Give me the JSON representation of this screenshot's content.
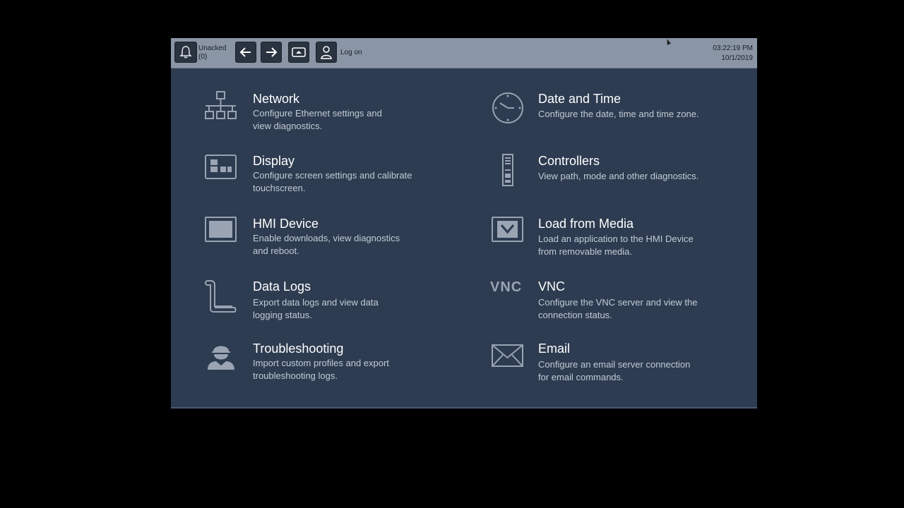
{
  "topbar": {
    "alarm_label_line1": "Unacked",
    "alarm_label_line2": "(0)",
    "logon_label": "Log on",
    "time": "03:22:19 PM",
    "date": "10/1/2019"
  },
  "tiles": [
    {
      "title": "Network",
      "desc1": "Configure Ethernet settings and",
      "desc2": "view diagnostics.",
      "icon": "network-icon"
    },
    {
      "title": "Date and Time",
      "desc1": "Configure the date, time and time zone.",
      "desc2": "",
      "icon": "clock-icon"
    },
    {
      "title": "Display",
      "desc1": "Configure screen settings and calibrate",
      "desc2": "touchscreen.",
      "icon": "display-icon"
    },
    {
      "title": "Controllers",
      "desc1": "View path, mode and other diagnostics.",
      "desc2": "",
      "icon": "controller-icon"
    },
    {
      "title": "HMI Device",
      "desc1": "Enable downloads, view diagnostics",
      "desc2": "and reboot.",
      "icon": "monitor-icon"
    },
    {
      "title": "Load from Media",
      "desc1": "Load an application to the HMI Device",
      "desc2": "from removable media.",
      "icon": "download-icon"
    },
    {
      "title": "Data Logs",
      "desc1": "Export data logs and view data",
      "desc2": "logging status.",
      "icon": "scroll-icon"
    },
    {
      "title": "VNC",
      "desc1": "Configure the VNC server and view the",
      "desc2": "connection status.",
      "icon": "vnc-icon",
      "icon_text": "VNC"
    },
    {
      "title": "Troubleshooting",
      "desc1": "Import custom profiles and export",
      "desc2": "troubleshooting logs.",
      "icon": "worker-icon"
    },
    {
      "title": "Email",
      "desc1": "Configure an email server connection",
      "desc2": "for email commands.",
      "icon": "envelope-icon"
    }
  ]
}
